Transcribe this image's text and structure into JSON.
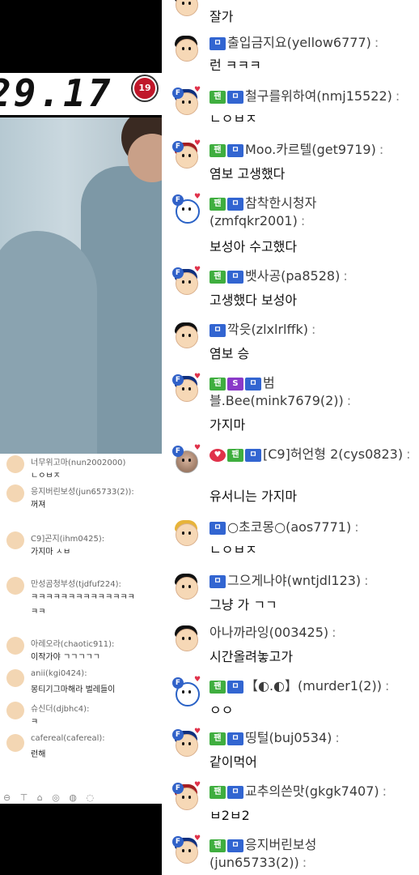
{
  "stream": {
    "timer": "29.17",
    "age_badge": "19"
  },
  "mini_chat": {
    "rows": [
      {
        "head": "너무위고마(nun2002000)",
        "msg": "ㄴㅇㅂㅈ"
      },
      {
        "head": "응지버린보성(jun65733(2)):",
        "msg": "꺼져"
      },
      {
        "head": "C9]곤지(ihm0425):",
        "msg": "가지마 ㅅㅂ"
      },
      {
        "head": "만성곰청부성(tjdfuf224):",
        "msg": "ㅋㅋㅋㅋㅋㅋㅋㅋㅋㅋㅋㅋㅋㅋ"
      },
      {
        "head": "ㅋㅋ",
        "msg": ""
      },
      {
        "head": "아레오라(chaotic911):",
        "msg": "이작가야 ㄱㄱㄱㄱㄱ"
      },
      {
        "head": "anii(kgi0424):",
        "msg": "몽티기그마해라 벌레들이"
      },
      {
        "head": "슈신더(djbhc4):",
        "msg": "ㅋ"
      },
      {
        "head": "cafereal(cafereal):",
        "msg": "런해"
      }
    ],
    "tools": "⊖ ⊤ ⌂ ◎ ◍ ◌"
  },
  "chat": {
    "messages": [
      {
        "name": "",
        "text": "잘가",
        "badges": [],
        "avatar": "hair-black"
      },
      {
        "name": "출입금지요(yellow6777)",
        "text": "런 ㅋㅋㅋ",
        "badges": [
          "sub"
        ],
        "avatar": "hair-black"
      },
      {
        "name": "철구를위하여(nmj15522)",
        "text": "ㄴㅇㅂㅈ",
        "badges": [
          "fan",
          "sub"
        ],
        "avatar": "hair-blue"
      },
      {
        "name": "Moo.카르텔(get9719)",
        "text": "염보 고생했다",
        "badges": [
          "fan",
          "sub"
        ],
        "avatar": "hair-red"
      },
      {
        "name": "참착한시청자 (zmfqkr2001)",
        "text": "보성아 수고했다",
        "badges": [
          "fan",
          "sub"
        ],
        "avatar": "panda"
      },
      {
        "name": "뱃사공(pa8528)",
        "text": "고생했다 보성아",
        "badges": [
          "fan",
          "sub"
        ],
        "avatar": "hair-blue"
      },
      {
        "name": "깍읏(zlxlrlffk)",
        "text": "염보 승",
        "badges": [
          "sub"
        ],
        "avatar": "hair-black"
      },
      {
        "name": "범 블.Bee(mink7679(2))",
        "text": "가지마",
        "badges": [
          "fan",
          "s",
          "sub"
        ],
        "avatar": "hair-blue"
      },
      {
        "name": "[C9]허언형 2(cys0823)",
        "text": "유서니는 가지마",
        "badges": [
          "heart",
          "fan",
          "sub"
        ],
        "avatar": "photo"
      },
      {
        "name": "○초코몽○(aos7771)",
        "text": "ㄴㅇㅂㅈ",
        "badges": [
          "sub"
        ],
        "avatar": "hair-blond"
      },
      {
        "name": "그으게나야(wntjdl123)",
        "text": "그냥 가 ㄱㄱ",
        "badges": [
          "sub"
        ],
        "avatar": "hair-black"
      },
      {
        "name": "아나까라잉(003425)",
        "text": "시간올려놓고가",
        "badges": [],
        "avatar": "hair-black"
      },
      {
        "name": "【◐.◐】(murder1(2))",
        "text": "ㅇㅇ",
        "badges": [
          "fan",
          "sub"
        ],
        "avatar": "panda"
      },
      {
        "name": "띵털(buj0534)",
        "text": "같이먹어",
        "badges": [
          "fan",
          "sub"
        ],
        "avatar": "hair-blue"
      },
      {
        "name": "교추의쓴맛(gkgk7407)",
        "text": "ㅂ2ㅂ2",
        "badges": [
          "fan",
          "sub"
        ],
        "avatar": "hair-red"
      },
      {
        "name": "응지버린보성 (jun65733(2))",
        "text": "",
        "badges": [
          "fan",
          "sub"
        ],
        "avatar": "hair-blue"
      }
    ],
    "badge_labels": {
      "fan": "팬",
      "sub": "ㅁ",
      "s": "S",
      "heart": "♥"
    }
  }
}
